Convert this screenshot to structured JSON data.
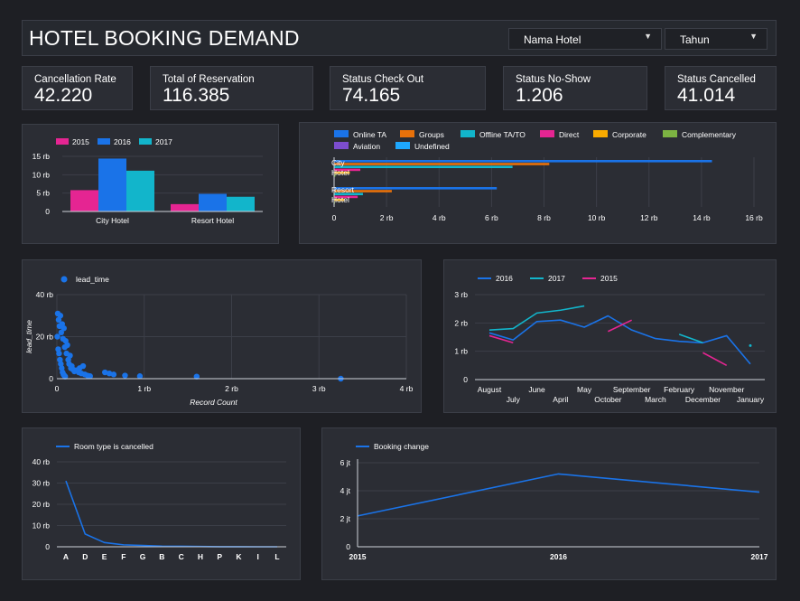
{
  "header": {
    "title": "HOTEL BOOKING DEMAND",
    "filters": [
      {
        "label": "Nama Hotel",
        "icon": "chevron-down-icon"
      },
      {
        "label": "Tahun",
        "icon": "chevron-down-icon"
      }
    ]
  },
  "kpis": [
    {
      "label": "Cancellation Rate",
      "value": "42.220"
    },
    {
      "label": "Total of Reservation",
      "value": "116.385"
    },
    {
      "label": "Status Check Out",
      "value": "74.165"
    },
    {
      "label": "Status No-Show",
      "value": "1.206"
    },
    {
      "label": "Status Cancelled",
      "value": "41.014"
    }
  ],
  "colors": {
    "background": "#1e1f24",
    "panel": "#2b2d34",
    "blue": "#1a73e8",
    "orange": "#e8710a",
    "cyan": "#12b5cb",
    "magenta": "#e52592",
    "yellow": "#f9ab00",
    "green": "#7cb342",
    "purple": "#7c4dce",
    "sky": "#1ea7fd"
  },
  "chart_data": [
    {
      "id": "bookings-by-hotel-year",
      "type": "bar",
      "categories": [
        "City Hotel",
        "Resort Hotel"
      ],
      "series": [
        {
          "name": "2015",
          "color": "#e52592",
          "values": [
            5800,
            2000
          ]
        },
        {
          "name": "2016",
          "color": "#1a73e8",
          "values": [
            14400,
            4800
          ]
        },
        {
          "name": "2017",
          "color": "#12b5cb",
          "values": [
            11100,
            4000
          ]
        }
      ],
      "yticks": [
        "0",
        "5 rb",
        "10 rb",
        "15 rb"
      ],
      "ylim": [
        0,
        15000
      ],
      "grid": true,
      "legend": "top-left"
    },
    {
      "id": "segment-by-hotel",
      "type": "bar",
      "orientation": "horizontal",
      "categories": [
        "City Hotel",
        "Resort Hotel"
      ],
      "series": [
        {
          "name": "Online TA",
          "color": "#1a73e8",
          "values": [
            14400,
            6200
          ]
        },
        {
          "name": "Groups",
          "color": "#e8710a",
          "values": [
            8200,
            2200
          ]
        },
        {
          "name": "Offline TA/TO",
          "color": "#12b5cb",
          "values": [
            6800,
            1100
          ]
        },
        {
          "name": "Direct",
          "color": "#e52592",
          "values": [
            1000,
            900
          ]
        },
        {
          "name": "Corporate",
          "color": "#f9ab00",
          "values": [
            600,
            400
          ]
        },
        {
          "name": "Complementary",
          "color": "#7cb342",
          "values": [
            50,
            30
          ]
        },
        {
          "name": "Aviation",
          "color": "#7c4dce",
          "values": [
            20,
            0
          ]
        },
        {
          "name": "Undefined",
          "color": "#1ea7fd",
          "values": [
            0,
            0
          ]
        }
      ],
      "xticks": [
        "0",
        "2 rb",
        "4 rb",
        "6 rb",
        "8 rb",
        "10 rb",
        "12 rb",
        "14 rb",
        "16 rb"
      ],
      "xlim": [
        0,
        16000
      ],
      "grid": true,
      "legend": "top"
    },
    {
      "id": "lead-time-scatter",
      "type": "scatter",
      "series": [
        {
          "name": "lead_time",
          "color": "#1a73e8"
        }
      ],
      "points": [
        [
          10,
          31000
        ],
        [
          20,
          28000
        ],
        [
          30,
          25000
        ],
        [
          40,
          30000
        ],
        [
          50,
          22000
        ],
        [
          60,
          26000
        ],
        [
          70,
          19000
        ],
        [
          80,
          24000
        ],
        [
          90,
          15000
        ],
        [
          100,
          18000
        ],
        [
          110,
          12000
        ],
        [
          120,
          16000
        ],
        [
          130,
          9000
        ],
        [
          140,
          7000
        ],
        [
          150,
          11000
        ],
        [
          160,
          5000
        ],
        [
          170,
          6000
        ],
        [
          180,
          4500
        ],
        [
          200,
          3500
        ],
        [
          220,
          4000
        ],
        [
          250,
          3000
        ],
        [
          280,
          2500
        ],
        [
          300,
          6000
        ],
        [
          320,
          2000
        ],
        [
          350,
          1500
        ],
        [
          380,
          1200
        ],
        [
          5,
          20000
        ],
        [
          15,
          14000
        ],
        [
          25,
          12000
        ],
        [
          35,
          9000
        ],
        [
          45,
          7000
        ],
        [
          55,
          5000
        ],
        [
          65,
          3000
        ],
        [
          75,
          2000
        ],
        [
          85,
          1500
        ],
        [
          95,
          1000
        ],
        [
          260,
          5000
        ],
        [
          550,
          3000
        ],
        [
          600,
          2500
        ],
        [
          650,
          2000
        ],
        [
          780,
          1500
        ],
        [
          950,
          1200
        ],
        [
          1600,
          1000
        ],
        [
          3250,
          0
        ]
      ],
      "xticks": [
        "0",
        "1 rb",
        "2 rb",
        "3 rb",
        "4 rb"
      ],
      "yticks": [
        "0",
        "20 rb",
        "40 rb"
      ],
      "xlim": [
        0,
        4000
      ],
      "ylim": [
        0,
        40000
      ],
      "xlabel": "Record Count",
      "ylabel": "lead_time",
      "grid": true,
      "legend": "top-left"
    },
    {
      "id": "monthly-trend",
      "type": "line",
      "categories": [
        "August",
        "July",
        "June",
        "April",
        "May",
        "October",
        "September",
        "March",
        "February",
        "December",
        "November",
        "January"
      ],
      "series": [
        {
          "name": "2016",
          "color": "#1a73e8",
          "values": [
            1650,
            1400,
            2050,
            2100,
            1850,
            2250,
            1750,
            1450,
            1350,
            1300,
            1550,
            550
          ]
        },
        {
          "name": "2017",
          "color": "#12b5cb",
          "values": [
            1750,
            1800,
            2350,
            2450,
            2600,
            null,
            null,
            null,
            1600,
            1300,
            null,
            1200
          ]
        },
        {
          "name": "2015",
          "color": "#e52592",
          "values": [
            1550,
            1300,
            null,
            null,
            null,
            1700,
            2100,
            null,
            null,
            950,
            500,
            null
          ]
        }
      ],
      "yticks": [
        "0",
        "1 rb",
        "2 rb",
        "3 rb"
      ],
      "ylim": [
        0,
        3000
      ],
      "grid": true,
      "legend": "top-left"
    },
    {
      "id": "room-type-cancelled",
      "type": "line",
      "categories": [
        "A",
        "D",
        "E",
        "F",
        "G",
        "B",
        "C",
        "H",
        "P",
        "K",
        "I",
        "L"
      ],
      "series": [
        {
          "name": "Room type is cancelled",
          "color": "#1a73e8",
          "values": [
            31000,
            6000,
            2000,
            900,
            600,
            300,
            250,
            150,
            20,
            10,
            5,
            1
          ]
        }
      ],
      "yticks": [
        "0",
        "10 rb",
        "20 rb",
        "30 rb",
        "40 rb"
      ],
      "ylim": [
        0,
        40000
      ],
      "grid": true,
      "legend": "top-left"
    },
    {
      "id": "booking-change",
      "type": "line",
      "categories": [
        "2015",
        "2016",
        "2017"
      ],
      "series": [
        {
          "name": "Booking change",
          "color": "#1a73e8",
          "values": [
            2200000,
            5200000,
            3900000
          ]
        }
      ],
      "yticks": [
        "0",
        "2 jt",
        "4 jt",
        "6 jt"
      ],
      "ylim": [
        0,
        6000000
      ],
      "grid": true,
      "legend": "top-left"
    }
  ]
}
